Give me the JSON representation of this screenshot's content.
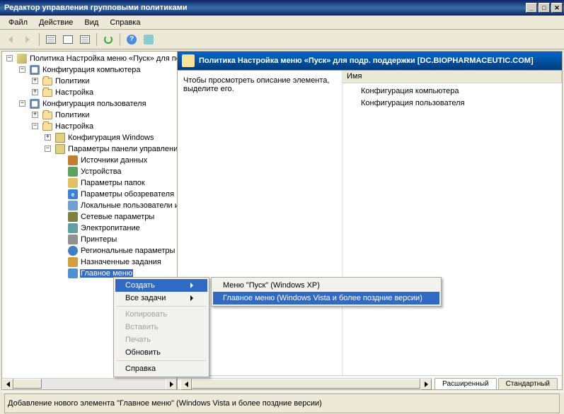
{
  "titlebar": {
    "title": "Редактор управления групповыми политиками"
  },
  "menubar": [
    "Файл",
    "Действие",
    "Вид",
    "Справка"
  ],
  "tree": {
    "root": "Политика Настройка меню «Пуск» для под",
    "compConfig": "Конфигурация компьютера",
    "policies": "Политики",
    "settings": "Настройка",
    "userConfig": "Конфигурация пользователя",
    "winConfig": "Конфигурация Windows",
    "ctrlPanel": "Параметры панели управления",
    "items": [
      "Источники данных",
      "Устройства",
      "Параметры папок",
      "Параметры обозревателя",
      "Локальные пользователи и",
      "Сетевые параметры",
      "Электропитание",
      "Принтеры",
      "Региональные параметры",
      "Назначенные задания",
      "Главное меню"
    ]
  },
  "ctx": {
    "create": "Создать",
    "allTasks": "Все задачи",
    "copy": "Копировать",
    "paste": "Вставить",
    "print": "Печать",
    "refresh": "Обновить",
    "help": "Справка"
  },
  "submenu": {
    "xp": "Меню \"Пуск\" (Windows XP)",
    "vista": "Главное меню (Windows Vista и более поздние версии)"
  },
  "rhead": "Политика Настройка меню «Пуск» для подр. поддержки [DC.BIOPHARMACEUTIC.COM]",
  "desc": "Чтобы просмотреть описание элемента, выделите его.",
  "listHeader": "Имя",
  "listItems": {
    "comp": "Конфигурация компьютера",
    "user": "Конфигурация пользователя"
  },
  "tabs": {
    "ext": "Расширенный",
    "std": "Стандартный"
  },
  "status": "Добавление нового элемента \"Главное меню\" (Windows Vista и более поздние версии)"
}
